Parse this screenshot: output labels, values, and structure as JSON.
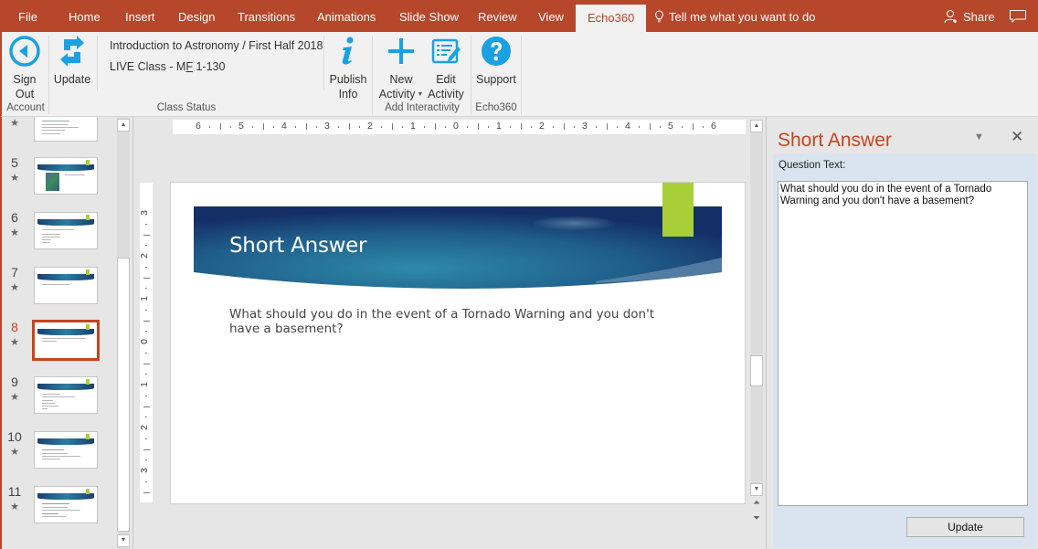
{
  "tabs": {
    "items": [
      {
        "label": "File"
      },
      {
        "label": "Home"
      },
      {
        "label": "Insert"
      },
      {
        "label": "Design"
      },
      {
        "label": "Transitions"
      },
      {
        "label": "Animations"
      },
      {
        "label": "Slide Show"
      },
      {
        "label": "Review"
      },
      {
        "label": "View"
      },
      {
        "label": "Echo360",
        "active": true
      }
    ],
    "tell_me": "Tell me what you want to do",
    "share": "Share"
  },
  "ribbon": {
    "account": {
      "sign_out": [
        "Sign",
        "Out"
      ],
      "group_label": "Account"
    },
    "class_status": {
      "update": "Update",
      "course": "Introduction to Astronomy / First Half 2018",
      "section_prefix": "LIVE Class - M",
      "section_underlined": "F",
      "section_suffix": " 1-130",
      "group_label": "Class Status"
    },
    "publish_info": [
      "Publish",
      "Info"
    ],
    "add_interactivity": {
      "new_activity": [
        "New",
        "Activity"
      ],
      "edit_activity": [
        "Edit",
        "Activity"
      ],
      "group_label": "Add Interactivity"
    },
    "echo360": {
      "support": "Support",
      "group_label": "Echo360"
    }
  },
  "thumbnails": [
    {
      "number": "",
      "starred": true,
      "kind": "bullets"
    },
    {
      "number": "5",
      "starred": true,
      "kind": "image"
    },
    {
      "number": "6",
      "starred": true,
      "kind": "bullets"
    },
    {
      "number": "7",
      "starred": true,
      "kind": "single"
    },
    {
      "number": "8",
      "starred": true,
      "kind": "single",
      "selected": true
    },
    {
      "number": "9",
      "starred": true,
      "kind": "bullets"
    },
    {
      "number": "10",
      "starred": true,
      "kind": "bullets"
    },
    {
      "number": "11",
      "starred": true,
      "kind": "bullets"
    }
  ],
  "ruler": {
    "horizontal": [
      "6",
      "5",
      "4",
      "3",
      "2",
      "1",
      "0",
      "1",
      "2",
      "3",
      "4",
      "5",
      "6"
    ],
    "vertical": [
      "3",
      "2",
      "1",
      "0",
      "1",
      "2",
      "3"
    ]
  },
  "slide": {
    "title": "Short Answer",
    "body": "What should you do in the event of a Tornado Warning and you don't have a basement?"
  },
  "pane": {
    "title": "Short Answer",
    "question_label": "Question Text:",
    "question_value": "What should you do in the event of a Tornado Warning and you don't have a basement?",
    "update_button": "Update"
  },
  "colors": {
    "accent": "#b7472a",
    "selection": "#c9431e",
    "echo_blue": "#1ba1e2",
    "slide_tag": "#a8cf37"
  }
}
